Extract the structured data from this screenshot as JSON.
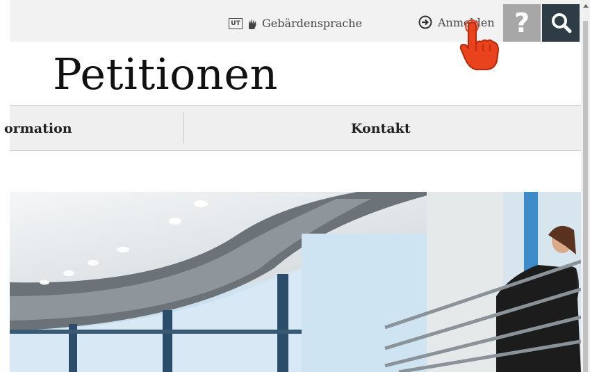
{
  "topbar": {
    "sign_language_label": "Gebärdensprache",
    "ut_badge": "UT",
    "login_label": "Anmelden",
    "help_label": "?"
  },
  "page_title": "Petitionen",
  "nav": {
    "items": [
      {
        "label": "ormation"
      },
      {
        "label": "Kontakt"
      }
    ]
  },
  "icons": {
    "sign_language": "hand-sign-icon",
    "login": "login-arrow-icon",
    "search": "search-icon",
    "help": "question-mark-icon",
    "cursor": "hand-pointer-cursor"
  },
  "colors": {
    "topbar_bg": "#f2f2f2",
    "help_bg": "#a7a7a7",
    "search_bg": "#2e3c45",
    "nav_bg": "#efefef",
    "cursor_red": "#e8431c"
  }
}
